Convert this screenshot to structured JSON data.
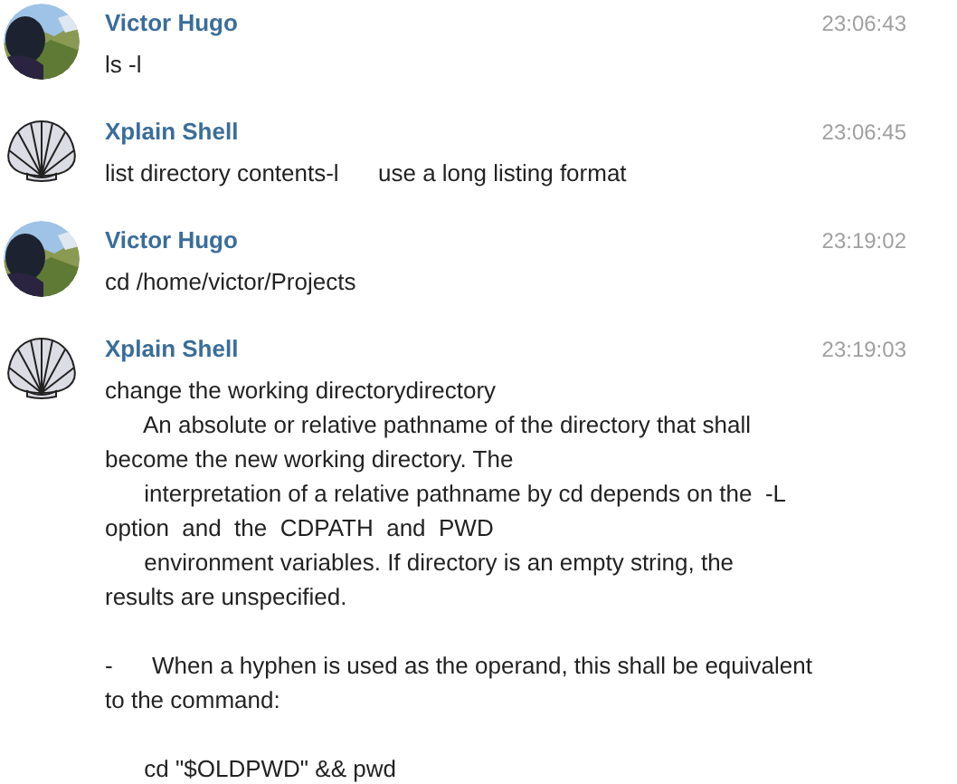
{
  "messages": [
    {
      "author": "Victor Hugo",
      "time": "23:06:43",
      "avatar": {
        "kind": "picture"
      },
      "paragraphs": [
        [
          "ls -l"
        ]
      ]
    },
    {
      "author": "Xplain Shell",
      "time": "23:06:45",
      "avatar": {
        "kind": "shell"
      },
      "paragraphs": [
        [
          "list directory contents-l      use a long listing format"
        ]
      ]
    },
    {
      "author": "Victor Hugo",
      "time": "23:19:02",
      "avatar": {
        "kind": "picture"
      },
      "paragraphs": [
        [
          "cd /home/victor/Projects"
        ]
      ]
    },
    {
      "author": "Xplain Shell",
      "time": "23:19:03",
      "avatar": {
        "kind": "shell"
      },
      "paragraphs": [
        [
          "change the working directorydirectory",
          "      An absolute or relative pathname of the directory that shall",
          "become the new working directory. The",
          "      interpretation of a relative pathname by cd depends on the  -L",
          "option  and  the  CDPATH  and  PWD",
          "      environment variables. If directory is an empty string, the",
          "results are unspecified."
        ],
        [
          "-      When a hyphen is used as the operand, this shall be equivalent",
          "to the command:"
        ],
        [
          "      cd \"$OLDPWD\" && pwd"
        ]
      ]
    }
  ]
}
